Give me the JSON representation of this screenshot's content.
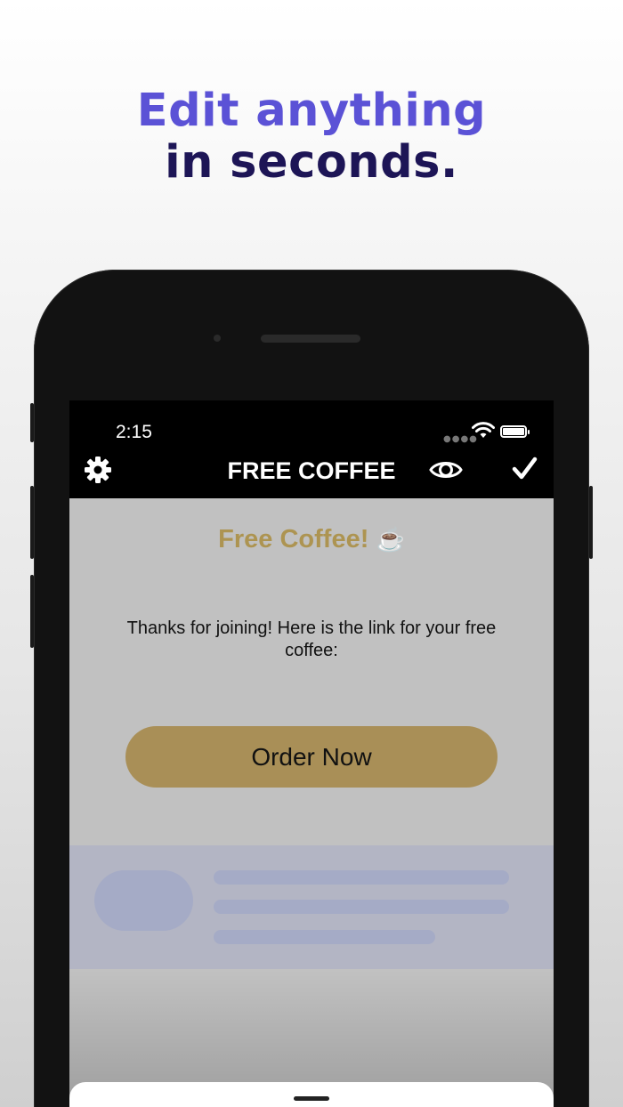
{
  "headline": {
    "line1": "Edit anything",
    "line2": "in seconds."
  },
  "status_bar": {
    "time": "2:15",
    "wifi_icon": "wifi-icon",
    "battery_icon": "battery-icon"
  },
  "navbar": {
    "title": "FREE COFFEE",
    "left_icon": "gear-icon",
    "preview_icon": "eye-icon",
    "done_icon": "checkmark-icon"
  },
  "content": {
    "title": "Free Coffee!",
    "title_emoji": "☕",
    "body": "Thanks for joining! Here is the link for your free coffee:",
    "button_label": "Order Now"
  },
  "colors": {
    "headline_accent": "#5b52d6",
    "headline_dark": "#1d1556",
    "title_gold": "#ad9451",
    "button_gold": "#a98f57",
    "screen_bg": "#c1c1c1"
  }
}
